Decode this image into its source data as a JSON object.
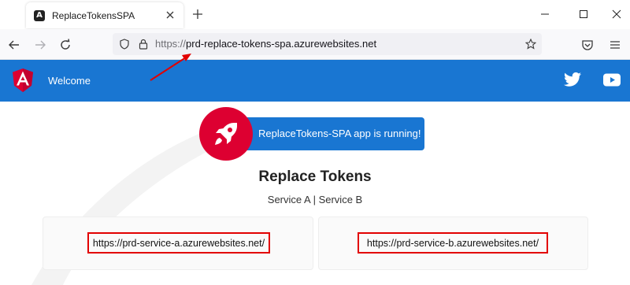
{
  "browser": {
    "tab": {
      "title": "ReplaceTokensSPA",
      "favicon": "angular-icon"
    },
    "url": {
      "scheme": "https://",
      "host": "prd-replace-tokens-spa.azurewebsites.net"
    }
  },
  "app": {
    "header": {
      "title": "Welcome",
      "icons": [
        "angular-logo",
        "twitter-icon",
        "youtube-icon"
      ]
    },
    "running_banner": {
      "text": "ReplaceTokens-SPA app is running!",
      "icon": "rocket-icon"
    },
    "section_title": "Replace Tokens",
    "services_line": "Service A | Service B",
    "service_cards": [
      {
        "url": "https://prd-service-a.azurewebsites.net/"
      },
      {
        "url": "https://prd-service-b.azurewebsites.net/"
      }
    ]
  },
  "colors": {
    "primary": "#1976d2",
    "angular_red": "#dd0031",
    "annotation_red": "#e20000"
  }
}
